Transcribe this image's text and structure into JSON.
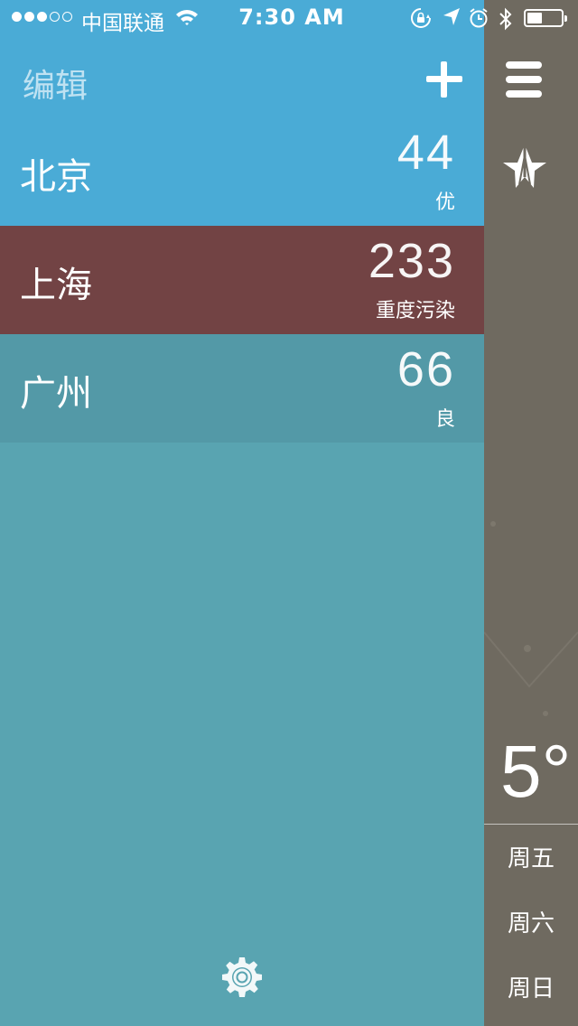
{
  "status_bar": {
    "carrier": "中国联通",
    "time": "7:30 AM",
    "signal_filled": 3,
    "signal_total": 5
  },
  "header": {
    "edit_label": "编辑",
    "add_icon": "plus-icon"
  },
  "cities": [
    {
      "name": "北京",
      "aqi": "44",
      "level": "优",
      "color": "#4aabd6"
    },
    {
      "name": "上海",
      "aqi": "233",
      "level": "重度污染",
      "color": "#724344"
    },
    {
      "name": "广州",
      "aqi": "66",
      "level": "良",
      "color": "#5399a7"
    }
  ],
  "settings_icon": "gear-icon",
  "main_panel": {
    "menu_icon": "hamburger-icon",
    "location_icon": "location-arrow-icon",
    "temperature": "5°",
    "days": [
      "周五",
      "周六",
      "周日"
    ]
  }
}
